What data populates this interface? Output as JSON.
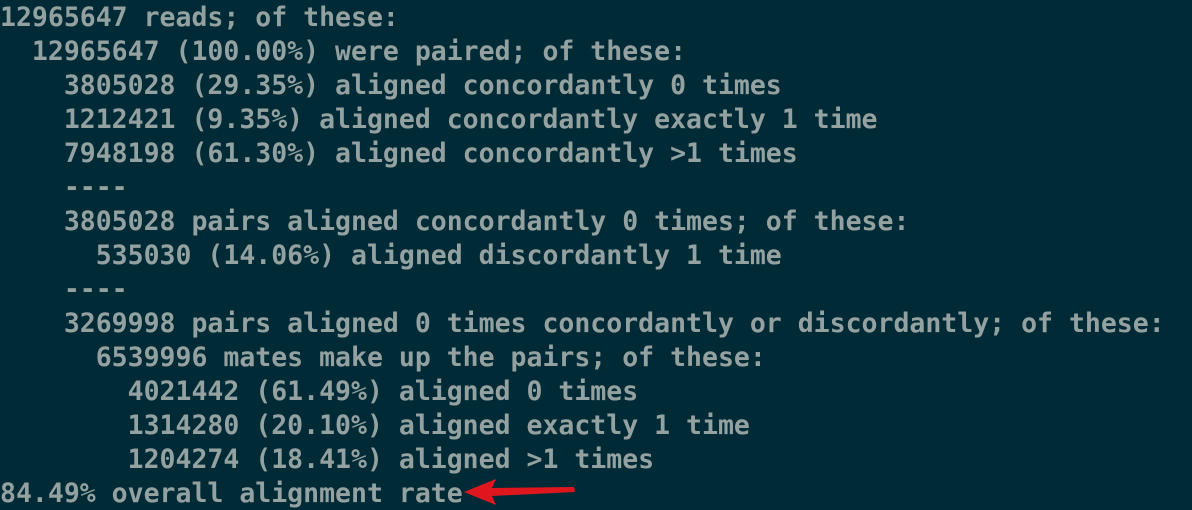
{
  "terminal": {
    "lines": [
      "12965647 reads; of these:",
      "  12965647 (100.00%) were paired; of these:",
      "    3805028 (29.35%) aligned concordantly 0 times",
      "    1212421 (9.35%) aligned concordantly exactly 1 time",
      "    7948198 (61.30%) aligned concordantly >1 times",
      "    ----",
      "    3805028 pairs aligned concordantly 0 times; of these:",
      "      535030 (14.06%) aligned discordantly 1 time",
      "    ----",
      "    3269998 pairs aligned 0 times concordantly or discordantly; of these:",
      "      6539996 mates make up the pairs; of these:",
      "        4021442 (61.49%) aligned 0 times",
      "        1314280 (20.10%) aligned exactly 1 time",
      "        1204274 (18.41%) aligned >1 times",
      "84.49% overall alignment rate"
    ]
  },
  "colors": {
    "background": "#002b36",
    "text": "#93a1a1",
    "annotation_arrow": "#e0161f"
  },
  "annotation": {
    "icon": "red-arrow-icon"
  }
}
